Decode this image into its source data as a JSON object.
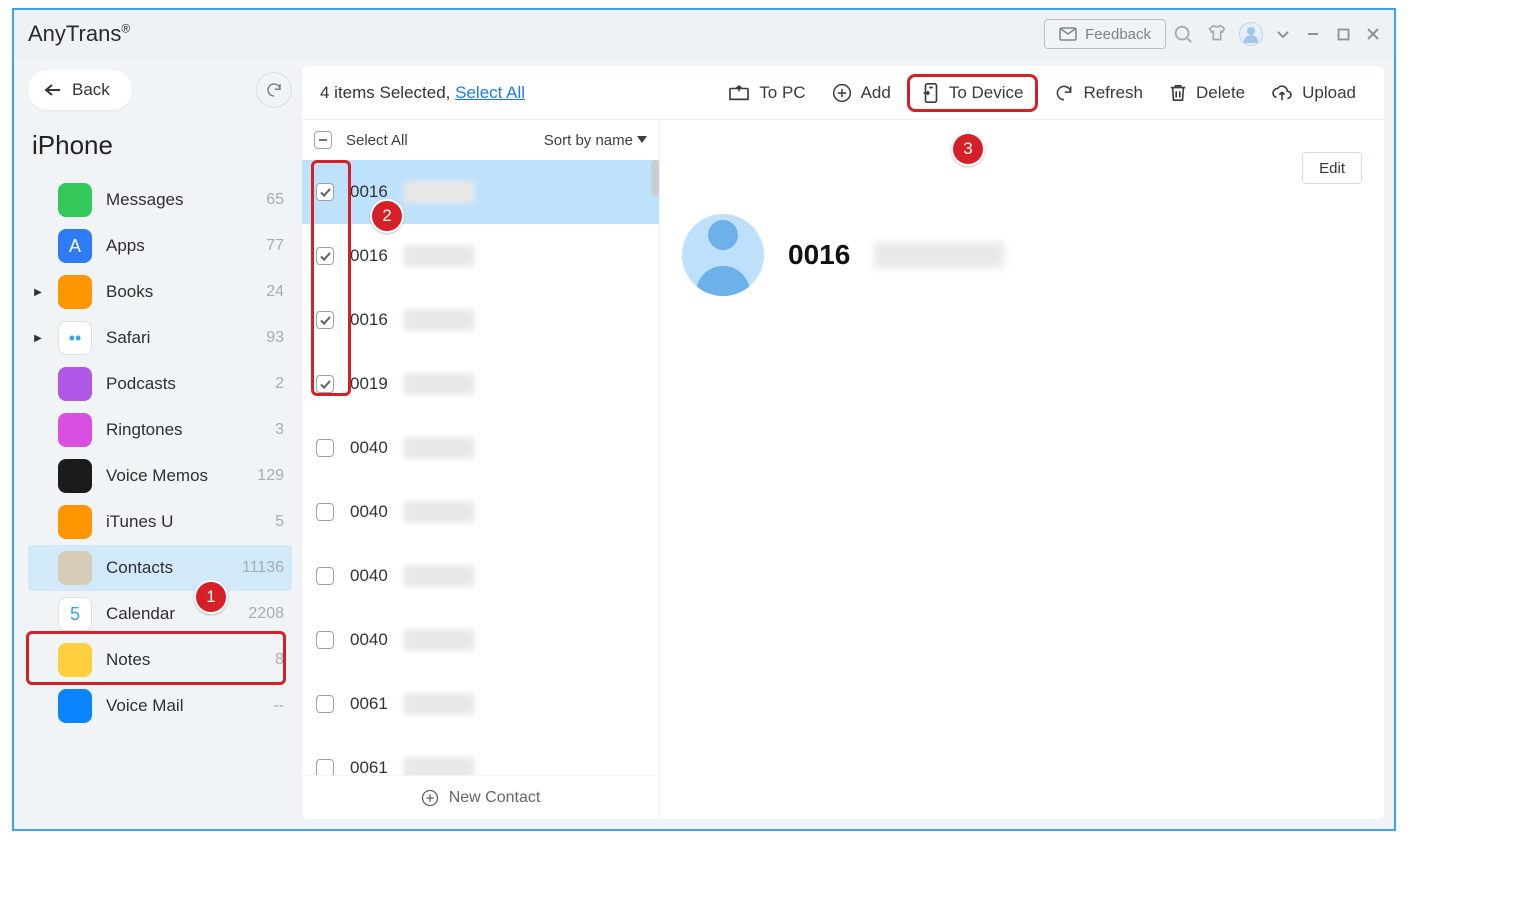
{
  "app": {
    "title": "AnyTrans",
    "trademark": "®"
  },
  "titlebar": {
    "feedback": "Feedback"
  },
  "sidebar": {
    "back_label": "Back",
    "device_title": "iPhone",
    "items": [
      {
        "label": "Messages",
        "count": "65",
        "icon_bg": "#34c759",
        "expandable": false
      },
      {
        "label": "Apps",
        "count": "77",
        "icon_bg": "#2f7bf5",
        "glyph": "A",
        "expandable": false
      },
      {
        "label": "Books",
        "count": "24",
        "icon_bg": "#ff9500",
        "expandable": true
      },
      {
        "label": "Safari",
        "count": "93",
        "icon_bg": "#ffffff",
        "expandable": true,
        "glyph": "••"
      },
      {
        "label": "Podcasts",
        "count": "2",
        "icon_bg": "#b158e8",
        "expandable": false
      },
      {
        "label": "Ringtones",
        "count": "3",
        "icon_bg": "#d84fe1",
        "expandable": false
      },
      {
        "label": "Voice Memos",
        "count": "129",
        "icon_bg": "#1b1b1b",
        "expandable": false
      },
      {
        "label": "iTunes U",
        "count": "5",
        "icon_bg": "#ff9500",
        "expandable": false
      },
      {
        "label": "Contacts",
        "count": "11136",
        "icon_bg": "#d7ccb7",
        "expandable": false,
        "selected": true
      },
      {
        "label": "Calendar",
        "count": "2208",
        "icon_bg": "#ffffff",
        "glyph": "5",
        "expandable": false
      },
      {
        "label": "Notes",
        "count": "8",
        "icon_bg": "#ffcf3f",
        "expandable": false
      },
      {
        "label": "Voice Mail",
        "count": "--",
        "icon_bg": "#0b84ff",
        "expandable": false
      }
    ]
  },
  "toolbar": {
    "selected_count": "4 items Selected, ",
    "select_all_link": "Select All",
    "to_pc": "To PC",
    "add": "Add",
    "to_device": "To Device",
    "refresh": "Refresh",
    "delete": "Delete",
    "upload": "Upload"
  },
  "list": {
    "header_select_all": "Select All",
    "header_sort": "Sort by name",
    "footer_new": "New Contact",
    "rows": [
      {
        "id": "0016",
        "checked": true,
        "selected": true
      },
      {
        "id": "0016",
        "checked": true
      },
      {
        "id": "0016",
        "checked": true
      },
      {
        "id": "0019",
        "checked": true
      },
      {
        "id": "0040",
        "checked": false
      },
      {
        "id": "0040",
        "checked": false
      },
      {
        "id": "0040",
        "checked": false
      },
      {
        "id": "0040",
        "checked": false
      },
      {
        "id": "0061",
        "checked": false
      },
      {
        "id": "0061",
        "checked": false
      }
    ]
  },
  "detail": {
    "name": "0016",
    "edit_label": "Edit"
  },
  "annotations": {
    "badge1": "1",
    "badge2": "2",
    "badge3": "3"
  }
}
